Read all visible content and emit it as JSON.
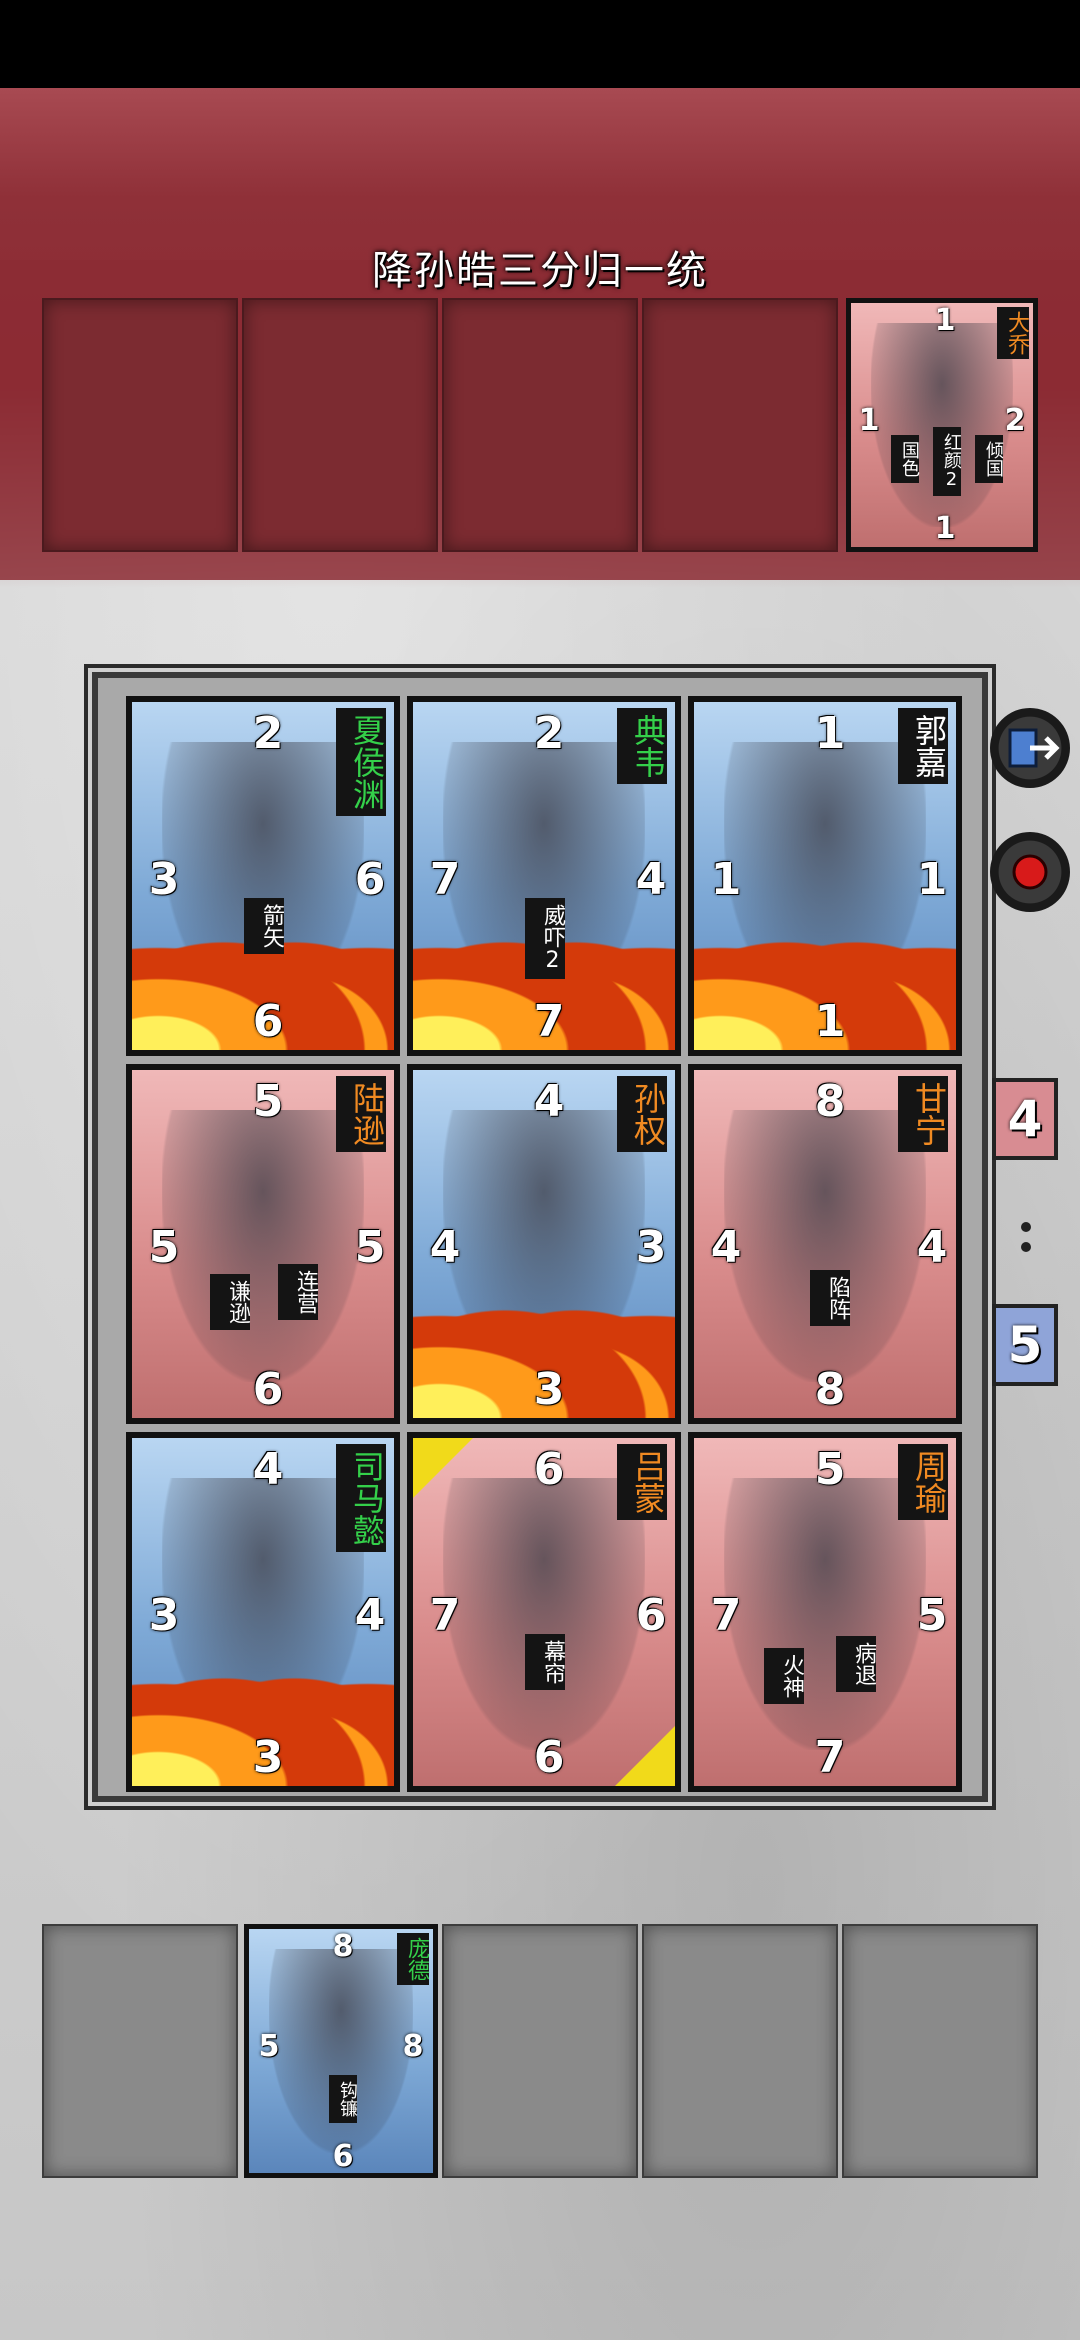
{
  "header": {
    "title": "降孙皓三分归一统"
  },
  "enemy_hand": {
    "card": {
      "name": "大乔",
      "top": "1",
      "left": "1",
      "right": "2",
      "bottom": "1",
      "skills": [
        "国色",
        "红颜2",
        "倾国"
      ]
    }
  },
  "board": {
    "cards": [
      {
        "name": "夏侯渊",
        "side": "blue",
        "top": "2",
        "left": "3",
        "right": "6",
        "bottom": "6",
        "skills": [
          "箭矢"
        ],
        "fire": true
      },
      {
        "name": "典韦",
        "side": "blue",
        "top": "2",
        "left": "7",
        "right": "4",
        "bottom": "7",
        "skills": [
          "威吓2"
        ],
        "fire": true
      },
      {
        "name": "郭嘉",
        "side": "blue",
        "top": "1",
        "left": "1",
        "right": "1",
        "bottom": "1",
        "skills": [],
        "fire": true
      },
      {
        "name": "陆逊",
        "side": "red",
        "top": "5",
        "left": "5",
        "right": "5",
        "bottom": "6",
        "skills": [
          "谦逊",
          "连营"
        ],
        "fire": false
      },
      {
        "name": "孙权",
        "side": "blue",
        "top": "4",
        "left": "4",
        "right": "3",
        "bottom": "3",
        "skills": [],
        "fire": true
      },
      {
        "name": "甘宁",
        "side": "red",
        "top": "8",
        "left": "4",
        "right": "4",
        "bottom": "8",
        "skills": [
          "陷阵"
        ],
        "fire": false
      },
      {
        "name": "司马懿",
        "side": "blue",
        "top": "4",
        "left": "3",
        "right": "4",
        "bottom": "3",
        "skills": [],
        "fire": true
      },
      {
        "name": "吕蒙",
        "side": "red",
        "top": "6",
        "left": "7",
        "right": "6",
        "bottom": "6",
        "skills": [
          "幕帘"
        ],
        "fire": false
      },
      {
        "name": "周瑜",
        "side": "red",
        "top": "5",
        "left": "7",
        "right": "5",
        "bottom": "7",
        "skills": [
          "火神",
          "病退"
        ],
        "fire": false
      }
    ]
  },
  "score": {
    "red": "4",
    "blue": "5"
  },
  "player_hand": {
    "card": {
      "name": "庞德",
      "top": "8",
      "left": "5",
      "right": "8",
      "bottom": "6",
      "skills": [
        "钩镰"
      ]
    }
  },
  "colors": {
    "blue_name": "#34d04a",
    "red_name": "#f08a22"
  },
  "icons": {
    "exit": "exit-icon",
    "record": "record-icon"
  }
}
